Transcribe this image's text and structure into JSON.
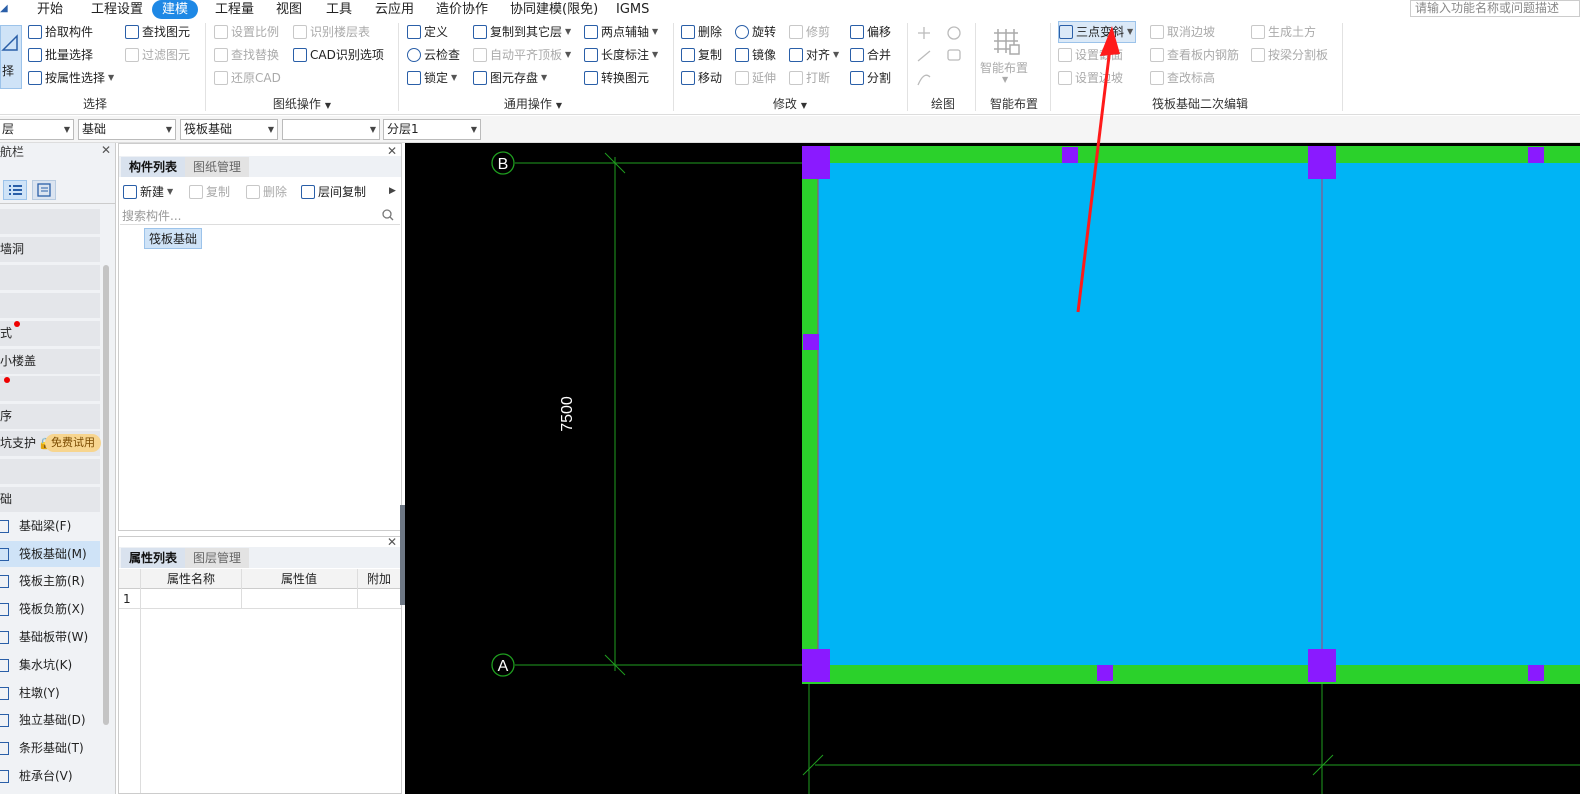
{
  "menu": {
    "items": [
      "开始",
      "工程设置",
      "建模",
      "工程量",
      "视图",
      "工具",
      "云应用",
      "造价协作",
      "协同建模(限免)",
      "IGMS"
    ],
    "active": "建模",
    "search_placeholder": "请输入功能名称或问题描述"
  },
  "ribbon": {
    "select_group": {
      "select_label": "择",
      "pick": "拾取构件",
      "batch": "批量选择",
      "by_attr": "按属性选择",
      "find": "查找图元",
      "filter": "过滤图元",
      "label": "选择"
    },
    "drawing_group": {
      "set_ratio": "设置比例",
      "identify_floor": "识别楼层表",
      "find_replace": "查找替换",
      "cad_options": "CAD识别选项",
      "restore_cad": "还原CAD",
      "label": "图纸操作"
    },
    "common_group": {
      "define": "定义",
      "cloud_check": "云检查",
      "lock": "锁定",
      "copy_to_floor": "复制到其它层",
      "auto_flat_top": "自动平齐顶板",
      "save_element": "图元存盘",
      "two_point_axis": "两点辅轴",
      "length_mark": "长度标注",
      "convert_element": "转换图元",
      "label": "通用操作"
    },
    "modify_group": {
      "delete": "删除",
      "rotate": "旋转",
      "trim": "修剪",
      "offset": "偏移",
      "copy": "复制",
      "mirror": "镜像",
      "align": "对齐",
      "merge": "合并",
      "move": "移动",
      "extend": "延伸",
      "break": "打断",
      "split": "分割",
      "label": "修改"
    },
    "draw_group": {
      "label": "绘图"
    },
    "smart_group": {
      "smart_layout": "智能布置",
      "label": "智能布置"
    },
    "raft_group": {
      "three_point_slope": "三点变斜",
      "cancel_edge_slope": "取消边坡",
      "gen_earthwork": "生成土方",
      "set_section": "设置截面",
      "view_rebar": "查看板内钢筋",
      "split_by_beam": "按梁分割板",
      "set_edge_slope": "设置边坡",
      "change_elevation": "查改标高",
      "label": "筏板基础二次编辑"
    }
  },
  "toolbar2": {
    "floor": "层",
    "category": "基础",
    "type": "筏板基础",
    "blank": "",
    "layer": "分层1"
  },
  "nav": {
    "title": "航栏",
    "items": [
      "",
      "墙洞",
      "",
      "",
      "式",
      "小楼盖",
      "",
      "序",
      "坑支护",
      "",
      "",
      "础"
    ],
    "free_trial": "免费试用",
    "subitems": [
      "基础梁(F)",
      "筏板基础(M)",
      "筏板主筋(R)",
      "筏板负筋(X)",
      "基础板带(W)",
      "集水坑(K)",
      "柱墩(Y)",
      "独立基础(D)",
      "条形基础(T)",
      "桩承台(V)"
    ]
  },
  "components": {
    "tab_list": "构件列表",
    "tab_drawing": "图纸管理",
    "new": "新建",
    "copy": "复制",
    "delete": "删除",
    "floor_copy": "层间复制",
    "search_placeholder": "搜索构件...",
    "item": "筏板基础"
  },
  "properties": {
    "tab_list": "属性列表",
    "tab_layer": "图层管理",
    "col_name": "属性名称",
    "col_value": "属性值",
    "col_extra": "附加",
    "row_num": "1"
  },
  "canvas": {
    "axis_b": "B",
    "axis_a": "A",
    "dimension": "7500"
  },
  "colors": {
    "accent": "#1e88e5",
    "slab_fill": "#00b4f5",
    "edge_green": "#2bd12b",
    "column_purple": "#8a1aff",
    "arrow_red": "#ff1a1a"
  }
}
